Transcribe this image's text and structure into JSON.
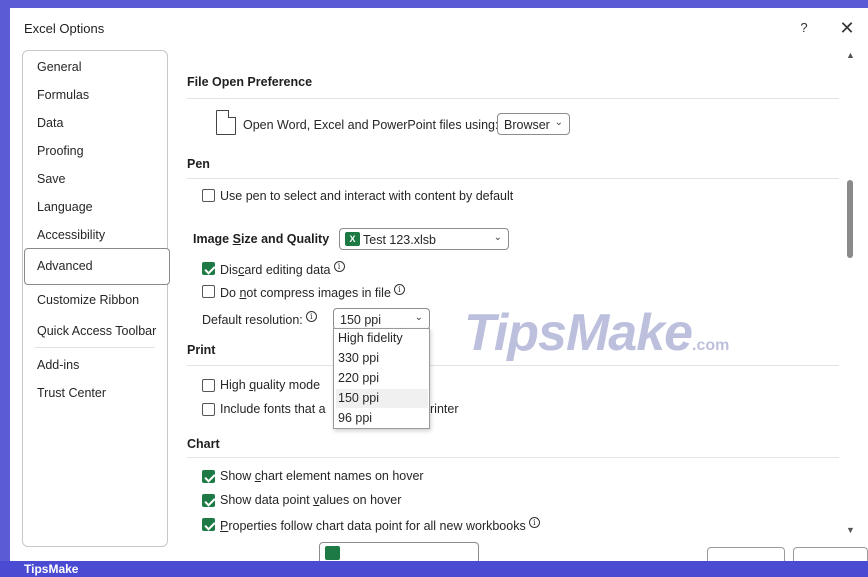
{
  "window": {
    "title": "Excel Options",
    "help_label": "?",
    "close_label": "✕"
  },
  "nav": {
    "items": [
      {
        "label": "General"
      },
      {
        "label": "Formulas"
      },
      {
        "label": "Data"
      },
      {
        "label": "Proofing"
      },
      {
        "label": "Save"
      },
      {
        "label": "Language"
      },
      {
        "label": "Accessibility"
      },
      {
        "label": "Advanced",
        "active": true
      },
      {
        "label": "Customize Ribbon"
      },
      {
        "label": "Quick Access Toolbar"
      },
      {
        "label": "Add-ins"
      },
      {
        "label": "Trust Center"
      }
    ]
  },
  "sections": {
    "file_open": {
      "title": "File Open Preference",
      "open_with_label": "Open Word, Excel and PowerPoint files using:",
      "open_with_value": "Browser"
    },
    "pen": {
      "title": "Pen",
      "use_pen_label": "Use pen to select and interact with content by default",
      "use_pen_checked": false
    },
    "image_size": {
      "title": "Image Size and Quality",
      "workbook_value": "Test 123.xlsb",
      "workbook_icon": "X",
      "discard_editing_label": "Discard editing data",
      "discard_editing_checked": true,
      "no_compress_label": "Do not compress images in file",
      "no_compress_checked": false,
      "default_resolution_label": "Default resolution:",
      "default_resolution_value": "150 ppi",
      "resolution_options": [
        "High fidelity",
        "330 ppi",
        "220 ppi",
        "150 ppi",
        "96 ppi"
      ]
    },
    "print": {
      "title": "Print",
      "high_quality_label": "High quality mode",
      "high_quality_checked": false,
      "include_fonts_label_start": "Include fonts that a",
      "include_fonts_label_end": "rinter",
      "include_fonts_checked": false
    },
    "chart": {
      "title": "Chart",
      "show_names_label": "Show chart element names on hover",
      "show_names_checked": true,
      "show_values_label": "Show data point values on hover",
      "show_values_checked": true,
      "properties_follow_label": "Properties follow chart data point for all new workbooks",
      "properties_follow_checked": true
    }
  },
  "watermark": {
    "text": "TipsMake",
    "suffix": ".com"
  },
  "bottom_bar": {
    "label": "TipsMake"
  },
  "colors": {
    "accent_green": "#1e7a44",
    "background": "#5b5bd6",
    "watermark": "#5f69af"
  },
  "icons": {
    "info": "info-icon",
    "document": "document-icon",
    "excel": "excel-file-icon",
    "chevron": "chevron-down-icon"
  }
}
